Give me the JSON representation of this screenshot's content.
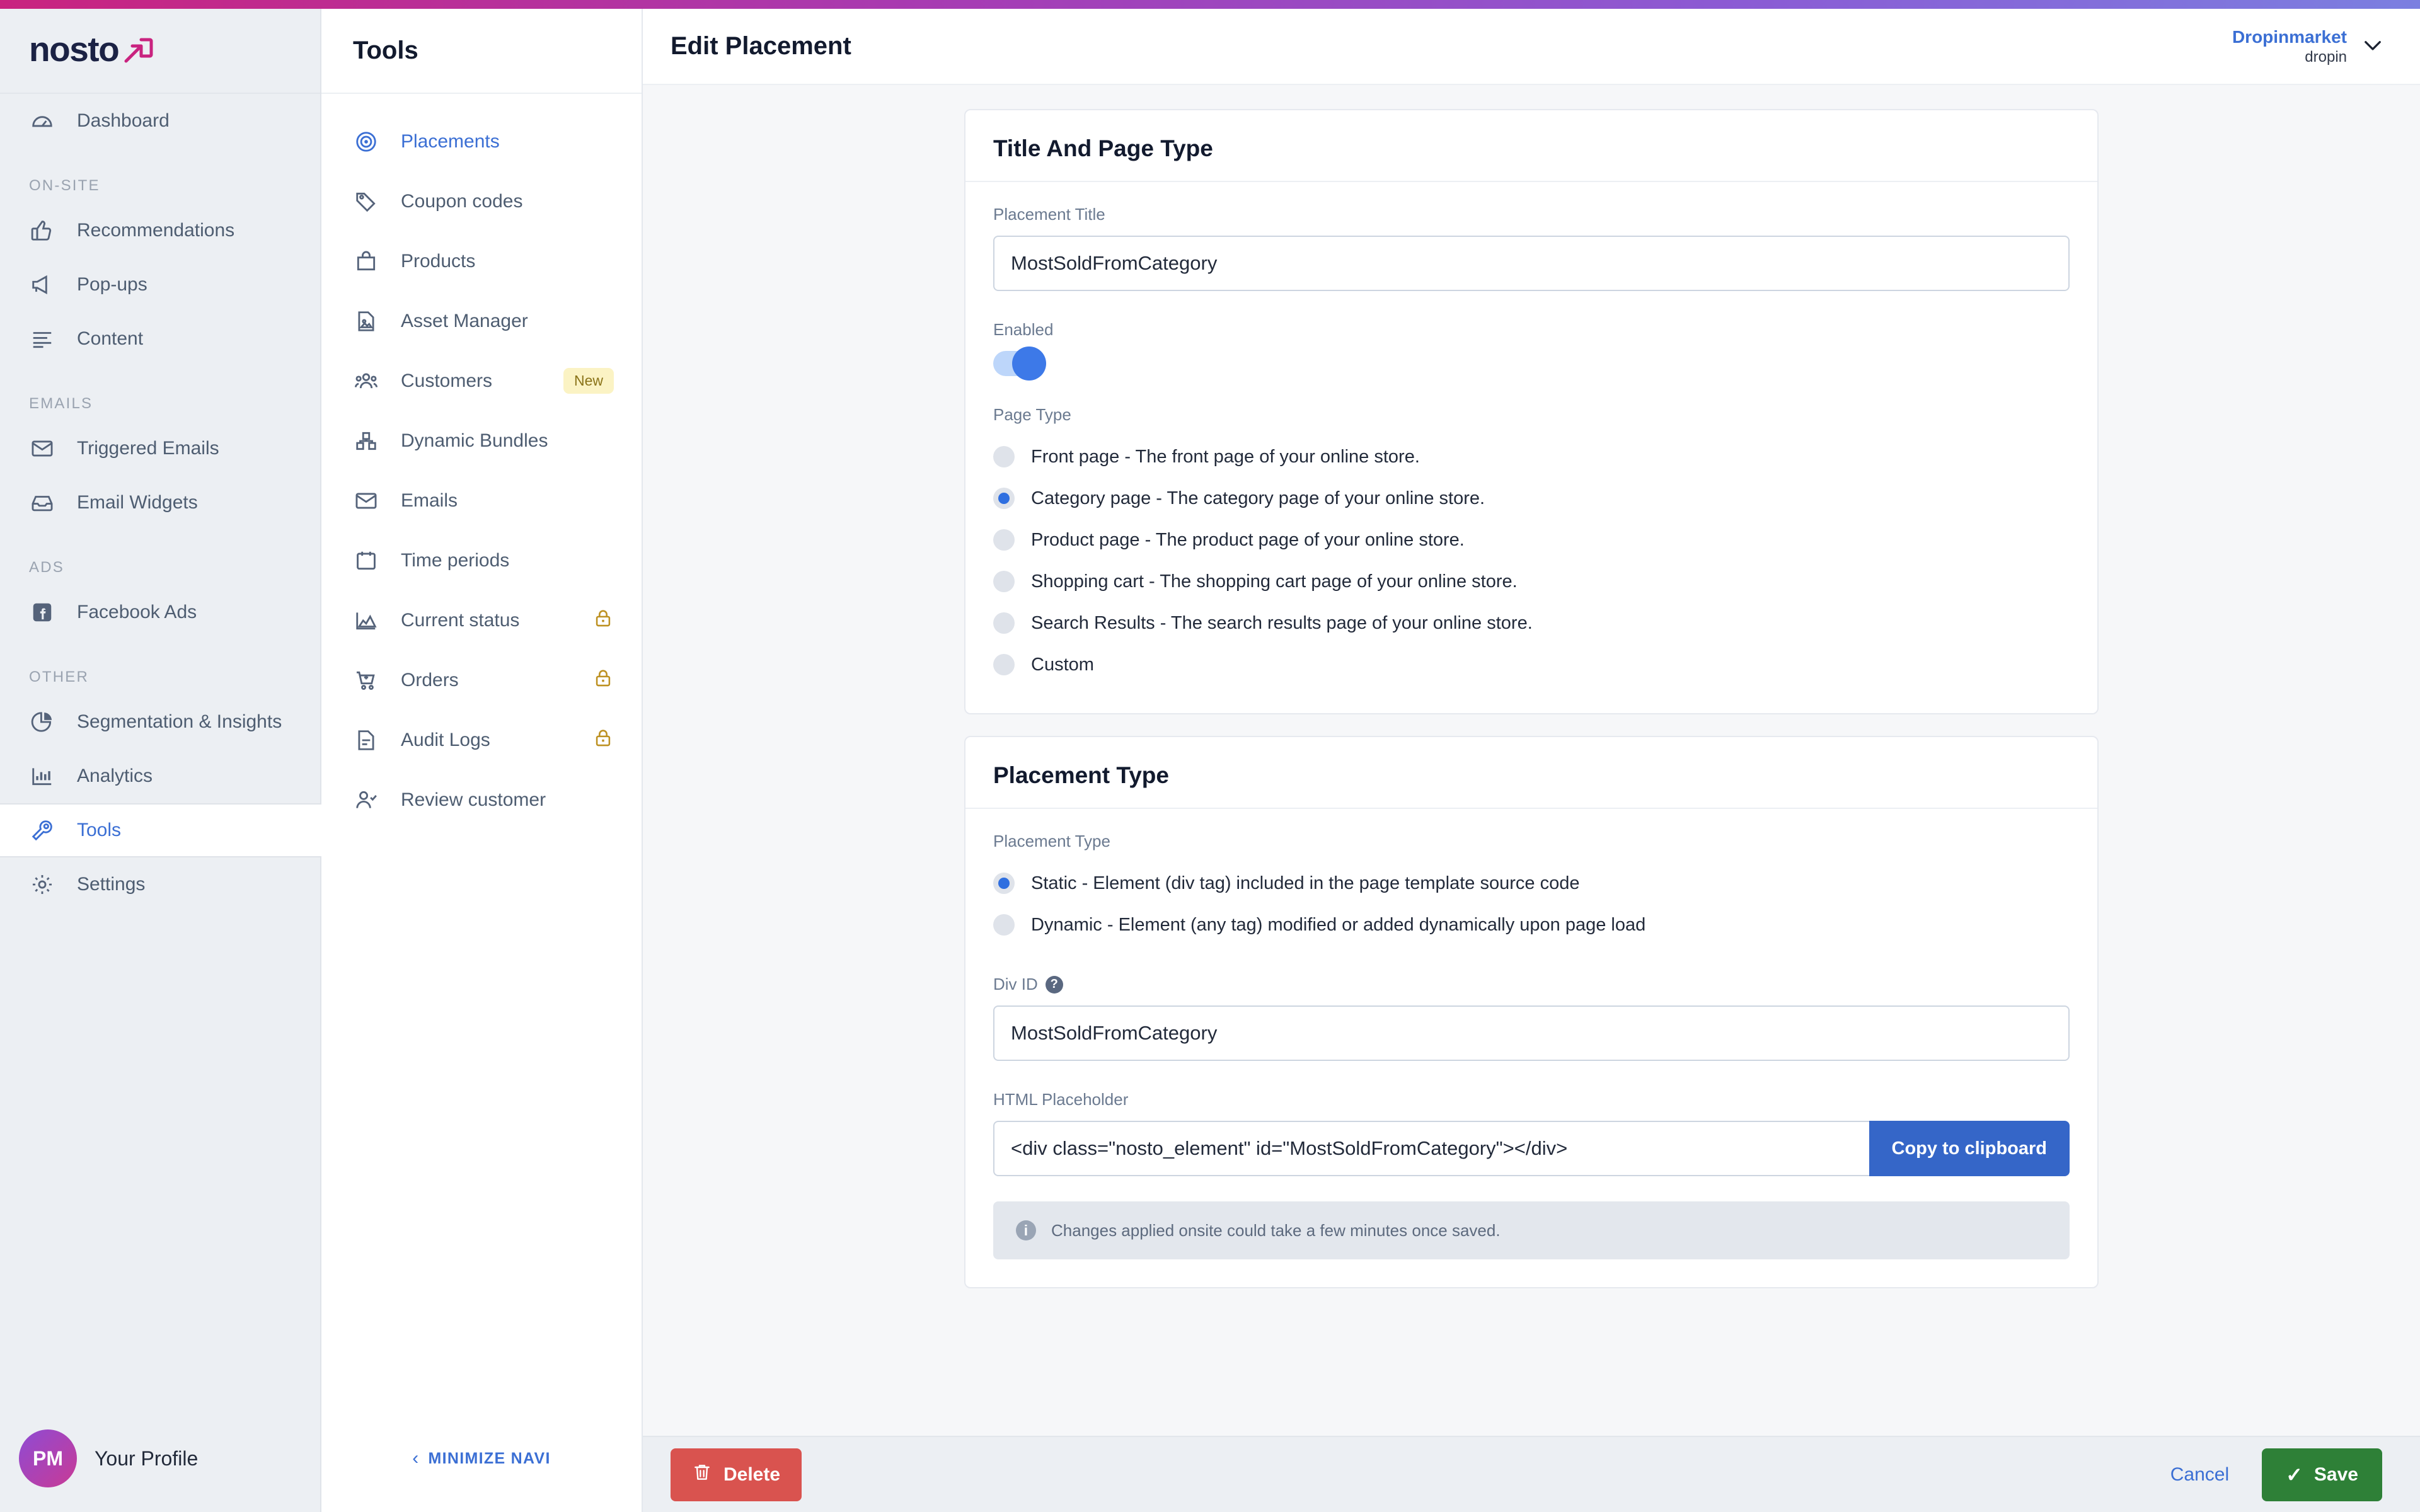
{
  "brand": {
    "logo_text": "nosto",
    "accent_pink": "#c9237f",
    "accent_blue": "#3b6fd4",
    "gradient_from": "#c9237f",
    "gradient_to": "#7b7fe0"
  },
  "primary_nav": {
    "items": [
      {
        "label": "Dashboard",
        "icon": "dashboard-gauge-icon",
        "active": false
      },
      {
        "label": "Recommendations",
        "icon": "thumbs-up-icon",
        "active": false
      },
      {
        "label": "Pop-ups",
        "icon": "megaphone-icon",
        "active": false
      },
      {
        "label": "Content",
        "icon": "lines-icon",
        "active": false
      },
      {
        "label": "Triggered Emails",
        "icon": "envelope-icon",
        "active": false
      },
      {
        "label": "Email Widgets",
        "icon": "inbox-icon",
        "active": false
      },
      {
        "label": "Facebook Ads",
        "icon": "facebook-icon",
        "active": false
      },
      {
        "label": "Segmentation & Insights",
        "icon": "pie-chart-icon",
        "active": false
      },
      {
        "label": "Analytics",
        "icon": "bar-chart-icon",
        "active": false
      },
      {
        "label": "Tools",
        "icon": "wrench-icon",
        "active": true
      },
      {
        "label": "Settings",
        "icon": "gear-icon",
        "active": false
      }
    ],
    "sections": {
      "on_site": "ON-SITE",
      "emails": "EMAILS",
      "ads": "ADS",
      "other": "OTHER"
    },
    "profile": {
      "initials": "PM",
      "name": "Your Profile"
    }
  },
  "tools_panel": {
    "title": "Tools",
    "minimize_label": "MINIMIZE NAVI",
    "minimize_chevron": "‹",
    "items": [
      {
        "label": "Placements",
        "icon": "target-icon",
        "active": true,
        "badge": "",
        "locked": false
      },
      {
        "label": "Coupon codes",
        "icon": "tag-icon",
        "active": false,
        "badge": "",
        "locked": false
      },
      {
        "label": "Products",
        "icon": "shopping-bag-icon",
        "active": false,
        "badge": "",
        "locked": false
      },
      {
        "label": "Asset Manager",
        "icon": "image-file-icon",
        "active": false,
        "badge": "",
        "locked": false
      },
      {
        "label": "Customers",
        "icon": "people-icon",
        "active": false,
        "badge": "New",
        "locked": false
      },
      {
        "label": "Dynamic Bundles",
        "icon": "boxes-icon",
        "active": false,
        "badge": "",
        "locked": false
      },
      {
        "label": "Emails",
        "icon": "envelope-icon",
        "active": false,
        "badge": "",
        "locked": false
      },
      {
        "label": "Time periods",
        "icon": "calendar-icon",
        "active": false,
        "badge": "",
        "locked": false
      },
      {
        "label": "Current status",
        "icon": "area-chart-icon",
        "active": false,
        "badge": "",
        "locked": true
      },
      {
        "label": "Orders",
        "icon": "cart-icon",
        "active": false,
        "badge": "",
        "locked": true
      },
      {
        "label": "Audit Logs",
        "icon": "document-icon",
        "active": false,
        "badge": "",
        "locked": true
      },
      {
        "label": "Review customer",
        "icon": "user-check-icon",
        "active": false,
        "badge": "",
        "locked": false
      }
    ]
  },
  "header": {
    "title": "Edit Placement",
    "account_name": "Dropinmarket",
    "account_sub": "dropin",
    "chevron": "⌄"
  },
  "cards": {
    "title_and_page_type": {
      "heading": "Title And Page Type",
      "placement_title_label": "Placement Title",
      "placement_title_value": "MostSoldFromCategory",
      "placement_title_placeholder": "Placement title",
      "enabled_label": "Enabled",
      "enabled_value": true,
      "page_type_label": "Page Type",
      "page_type_options": [
        {
          "label": "Front page - The front page of your online store.",
          "selected": false
        },
        {
          "label": "Category page - The category page of your online store.",
          "selected": true
        },
        {
          "label": "Product page - The product page of your online store.",
          "selected": false
        },
        {
          "label": "Shopping cart - The shopping cart page of your online store.",
          "selected": false
        },
        {
          "label": "Search Results - The search results page of your online store.",
          "selected": false
        },
        {
          "label": "Custom",
          "selected": false
        }
      ]
    },
    "placement_type": {
      "heading": "Placement Type",
      "placement_type_label": "Placement Type",
      "placement_type_options": [
        {
          "label": "Static - Element (div tag) included in the page template source code",
          "selected": true
        },
        {
          "label": "Dynamic - Element (any tag) modified or added dynamically upon page load",
          "selected": false
        }
      ],
      "div_id_label": "Div ID",
      "div_id_help": "?",
      "div_id_value": "MostSoldFromCategory",
      "div_id_placeholder": "Div ID",
      "html_placeholder_label": "HTML Placeholder",
      "html_placeholder_value": "<div class=\"nosto_element\" id=\"MostSoldFromCategory\"></div>",
      "copy_button_label": "Copy to clipboard",
      "info_icon": "i",
      "info_message": "Changes applied onsite could take a few minutes once saved."
    }
  },
  "action_bar": {
    "delete_label": "Delete",
    "cancel_label": "Cancel",
    "save_label": "Save",
    "save_check": "✓"
  }
}
